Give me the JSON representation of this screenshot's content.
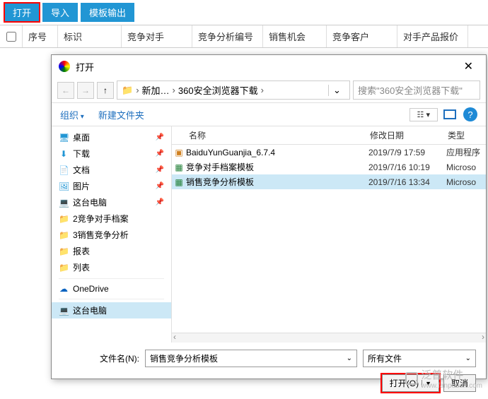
{
  "toolbar": {
    "open": "打开",
    "import": "导入",
    "template_out": "模板输出"
  },
  "table_headers": {
    "seq": "序号",
    "mark": "标识",
    "competitor": "竞争对手",
    "analysis_no": "竞争分析编号",
    "opportunity": "销售机会",
    "customer": "竞争客户",
    "price": "对手产品报价"
  },
  "dialog": {
    "title": "打开",
    "breadcrumb": {
      "seg1": "新加…",
      "seg2": "360安全浏览器下载"
    },
    "search_placeholder": "搜索\"360安全浏览器下载\"",
    "organize": "组织",
    "new_folder": "新建文件夹",
    "view_option": "☷ ▾",
    "sidebar": [
      {
        "icon": "ico-desktop",
        "glyph": "🖥",
        "label": "桌面",
        "pin": true
      },
      {
        "icon": "ico-dl",
        "glyph": "⬇",
        "label": "下载",
        "pin": true
      },
      {
        "icon": "ico-doc",
        "glyph": "📄",
        "label": "文档",
        "pin": true
      },
      {
        "icon": "ico-pic",
        "glyph": "🖼",
        "label": "图片",
        "pin": true
      },
      {
        "icon": "ico-pc",
        "glyph": "💻",
        "label": "这台电脑",
        "pin": true
      },
      {
        "icon": "ico-folder",
        "glyph": "📁",
        "label": "2竞争对手档案",
        "pin": false
      },
      {
        "icon": "ico-folder",
        "glyph": "📁",
        "label": "3销售竞争分析",
        "pin": false
      },
      {
        "icon": "ico-folder",
        "glyph": "📁",
        "label": "报表",
        "pin": false
      },
      {
        "icon": "ico-folder",
        "glyph": "📁",
        "label": "列表",
        "pin": false
      }
    ],
    "onedrive": "OneDrive",
    "this_pc": "这台电脑",
    "columns": {
      "name": "名称",
      "date": "修改日期",
      "type": "类型"
    },
    "files": [
      {
        "icon": "ico-exe",
        "glyph": "▣",
        "name": "BaiduYunGuanjia_6.7.4",
        "date": "2019/7/9 17:59",
        "type": "应用程序",
        "selected": false
      },
      {
        "icon": "ico-xls",
        "glyph": "▦",
        "name": "竞争对手档案模板",
        "date": "2019/7/16 10:19",
        "type": "Microso",
        "selected": false
      },
      {
        "icon": "ico-xls",
        "glyph": "▦",
        "name": "销售竞争分析模板",
        "date": "2019/7/16 13:34",
        "type": "Microso",
        "selected": true
      }
    ],
    "filename_label": "文件名(N):",
    "filename_value": "销售竞争分析模板",
    "filter": "所有文件",
    "open_btn": "打开(O)",
    "cancel_btn": "取消"
  },
  "watermark": {
    "brand": "泛普软件",
    "url": "www.fanpusoft.com"
  }
}
